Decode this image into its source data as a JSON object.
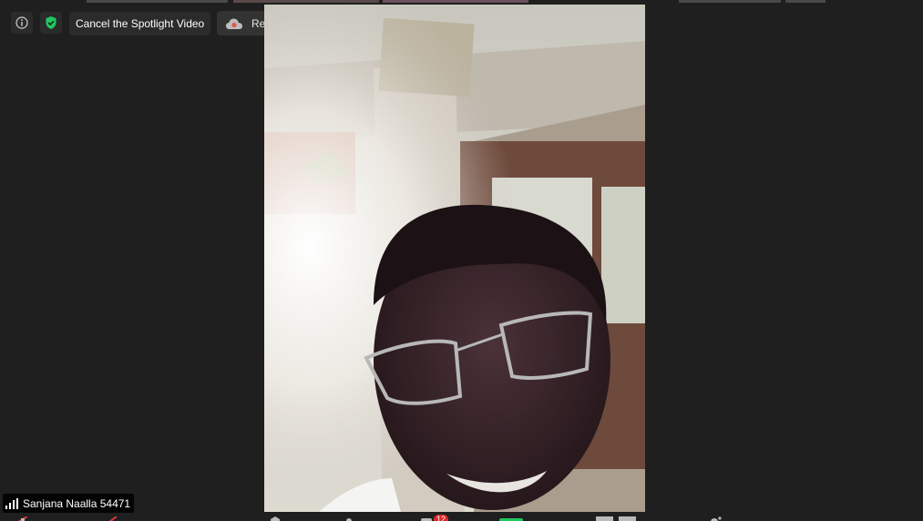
{
  "spotlight": {
    "label": "Cancel the Spotlight Video"
  },
  "recording": {
    "label": "Recording...",
    "status_color": "#e0564f"
  },
  "participant": {
    "name": "Sanjana Naalla 54471"
  },
  "toolbar": {
    "participants_badge": "12"
  },
  "colors": {
    "background": "#1f1f1f",
    "secure_green": "#22c55e",
    "badge_red": "#e02828"
  },
  "icons": {
    "info": "info-icon",
    "security": "shield-check-icon",
    "record": "cloud-record-icon",
    "pause": "pause-icon",
    "stop": "stop-icon",
    "signal": "signal-bars-icon"
  }
}
